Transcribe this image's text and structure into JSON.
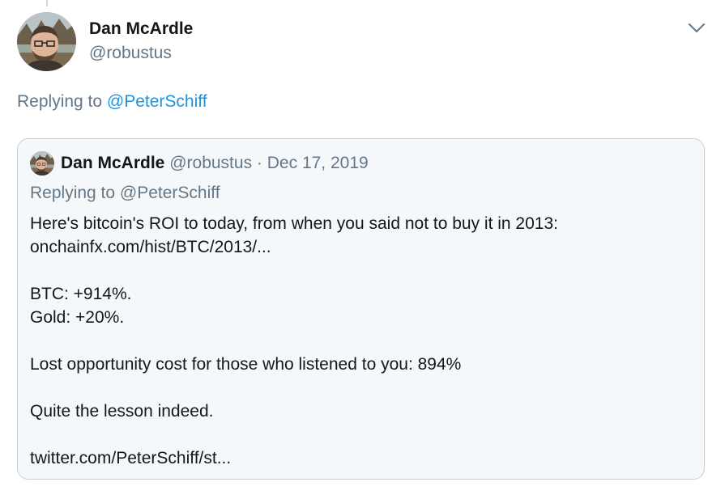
{
  "tweet": {
    "author_name": "Dan McArdle",
    "author_handle": "@robustus",
    "replying_prefix": "Replying to ",
    "replying_to": "@PeterSchiff"
  },
  "quoted_tweet": {
    "author_name": "Dan McArdle",
    "author_handle": "@robustus",
    "separator": "·",
    "date": "Dec 17, 2019",
    "replying_text": "Replying to @PeterSchiff",
    "body_lines": [
      "Here's bitcoin's ROI to today, from when you said not to buy it in 2013:",
      "onchainfx.com/hist/BTC/2013/...",
      "",
      "BTC: +914%.",
      "Gold: +20%.",
      "",
      "Lost opportunity cost for those who listened to you: 894%",
      "",
      "Quite the lesson indeed.",
      "",
      "twitter.com/PeterSchiff/st..."
    ]
  },
  "icons": {
    "caret": "chevron-down-icon",
    "avatar": "user-avatar"
  },
  "colors": {
    "link": "#1b95e0",
    "secondary_text": "#657786",
    "primary_text": "#14171a",
    "quote_bg": "#f5f8fa",
    "quote_border": "#c4cfd6"
  }
}
